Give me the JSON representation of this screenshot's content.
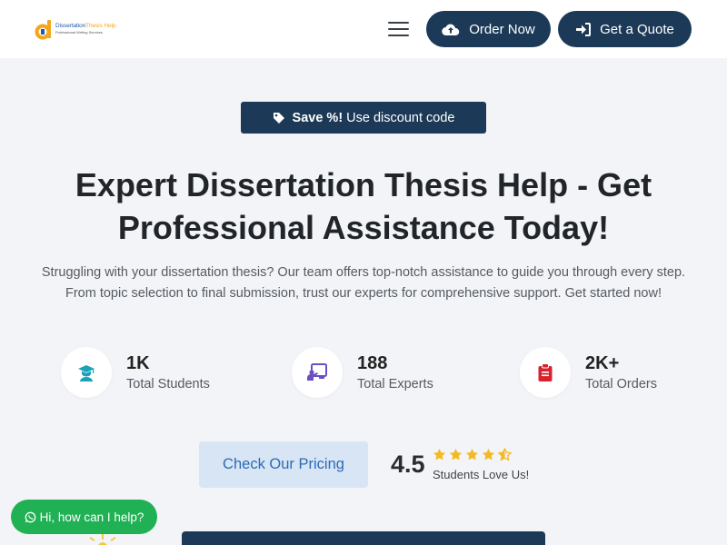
{
  "header": {
    "logo": {
      "name_main": "Dissertation",
      "name_accent": "Thesis Help",
      "tagline": "Professional Writing Services"
    },
    "menu_icon": "hamburger-menu-icon",
    "order_button": {
      "label": "Order Now",
      "icon": "cloud-upload-icon"
    },
    "quote_button": {
      "label": "Get a Quote",
      "icon": "sign-in-icon"
    }
  },
  "hero": {
    "promo": {
      "bold": "Save %!",
      "text": "Use discount code",
      "icon": "tag-icon"
    },
    "title_line1": "Expert Dissertation Thesis Help - Get",
    "title_line2": "Professional Assistance Today!",
    "description_line1": "Struggling with your dissertation thesis? Our team offers top-notch assistance to guide you through every step.",
    "description_line2": "From topic selection to final submission, trust our experts for comprehensive support. Get started now!"
  },
  "stats": [
    {
      "value": "1K",
      "label": "Total Students",
      "icon": "graduate-icon"
    },
    {
      "value": "188",
      "label": "Total Experts",
      "icon": "teacher-board-icon"
    },
    {
      "value": "2K+",
      "label": "Total Orders",
      "icon": "clipboard-icon"
    }
  ],
  "pricing_button": {
    "label": "Check Our Pricing"
  },
  "rating": {
    "value": "4.5",
    "stars": 4.5,
    "label": "Students Love Us!"
  },
  "chat": {
    "label": "Hi, how can I help?",
    "icon": "whatsapp-icon"
  },
  "colors": {
    "navy": "#1c3a57",
    "page_bg": "#f2f4f7",
    "star": "#f5b921",
    "chat_green": "#1fb154",
    "pricing_bg": "#d8e5f4",
    "pricing_text": "#2a6cb4",
    "teal_icon": "#1aa3b8",
    "purple_icon": "#6a4fc4",
    "red_icon": "#d8232f"
  }
}
